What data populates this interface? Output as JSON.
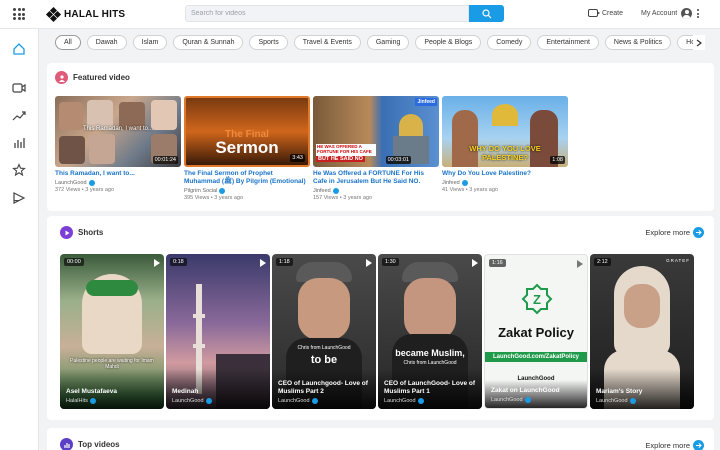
{
  "header": {
    "logo_text": "HALAL HITS",
    "search_placeholder": "Search for videos",
    "create_label": "Create",
    "account_label": "My Account"
  },
  "sidebar": {
    "items": [
      {
        "icon": "home-icon",
        "active": true
      },
      {
        "icon": "video-camera-icon"
      },
      {
        "icon": "trending-icon"
      },
      {
        "icon": "chart-icon"
      },
      {
        "icon": "star-icon"
      },
      {
        "icon": "playlist-icon"
      }
    ]
  },
  "categories": [
    "All",
    "Dawah",
    "Islam",
    "Quran & Sunnah",
    "Sports",
    "Travel & Events",
    "Gaming",
    "People & Blogs",
    "Comedy",
    "Entertainment",
    "News & Politics",
    "How-to & Style"
  ],
  "featured": {
    "title": "Featured video",
    "videos": [
      {
        "title": "This Ramadan, I want to...",
        "channel": "LaunchGood",
        "meta": "372 Views • 3 years ago",
        "duration": "00:01:24",
        "thumb_text": "This Ramadan, I want to..."
      },
      {
        "title": "The Final Sermon of Prophet Muhammad (ﷺ) By Pilgrim (Emotional)",
        "channel": "Pilgrim Social",
        "meta": "395 Views • 3 years ago",
        "duration": "3:43",
        "thumb_text_1": "The Final",
        "thumb_text_2": "Sermon"
      },
      {
        "title": "He Was Offered a FORTUNE For His Cafe in Jerusalem But He Said NO.",
        "channel": "Jinfeed",
        "meta": "157 Views • 3 years ago",
        "duration": "00:03:01",
        "thumb_text": "HE WAS OFFERED A FORTUNE FOR HIS CAFE",
        "thumb_text_2": "BUT HE SAID NO",
        "badge": "Jinfeed"
      },
      {
        "title": "Why Do You Love Palestine?",
        "channel": "Jinfeed",
        "meta": "41 Views • 3 years ago",
        "duration": "1:08",
        "thumb_text": "WHY DO YOU LOVE",
        "thumb_text_2": "PALESTINE?"
      }
    ]
  },
  "shorts": {
    "title": "Shorts",
    "explore_label": "Explore more",
    "items": [
      {
        "title": "Asel Mustafaeva",
        "channel": "HalalHits",
        "duration": "00:00",
        "caption": "Palestine people are waiting for Imam Mahdi"
      },
      {
        "title": "Medinah",
        "channel": "LaunchGood",
        "duration": "0:18"
      },
      {
        "title": "CEO of Launchgood- Love of Muslims Part 2",
        "channel": "LaunchGood",
        "duration": "1:18",
        "caption": "to be",
        "caption_small": "Chris from LaunchGood"
      },
      {
        "title": "CEO of LaunchGood- Love of Muslims Part 1",
        "channel": "LaunchGood",
        "duration": "1:30",
        "caption": "became Muslim,",
        "caption_small": "Chris from LaunchGood"
      },
      {
        "title": "Zakat on LaunchGood",
        "channel": "LaunchGood",
        "duration": "1:16",
        "caption": "Zakat Policy",
        "caption_2": "LaunchGood.com/ZakatPolicy",
        "caption_3": "LaunchGood"
      },
      {
        "title": "Mariam's Story",
        "channel": "LaunchGood",
        "duration": "2:12",
        "badge": "GRATEF"
      }
    ]
  },
  "top_videos": {
    "title": "Top videos",
    "explore_label": "Explore more"
  },
  "colors": {
    "accent": "#1a9be6",
    "link": "#1a73c8",
    "featured_icon": "#e05a7a",
    "shorts_icon": "#7b3fd6",
    "top_icon": "#5a3fc6"
  }
}
